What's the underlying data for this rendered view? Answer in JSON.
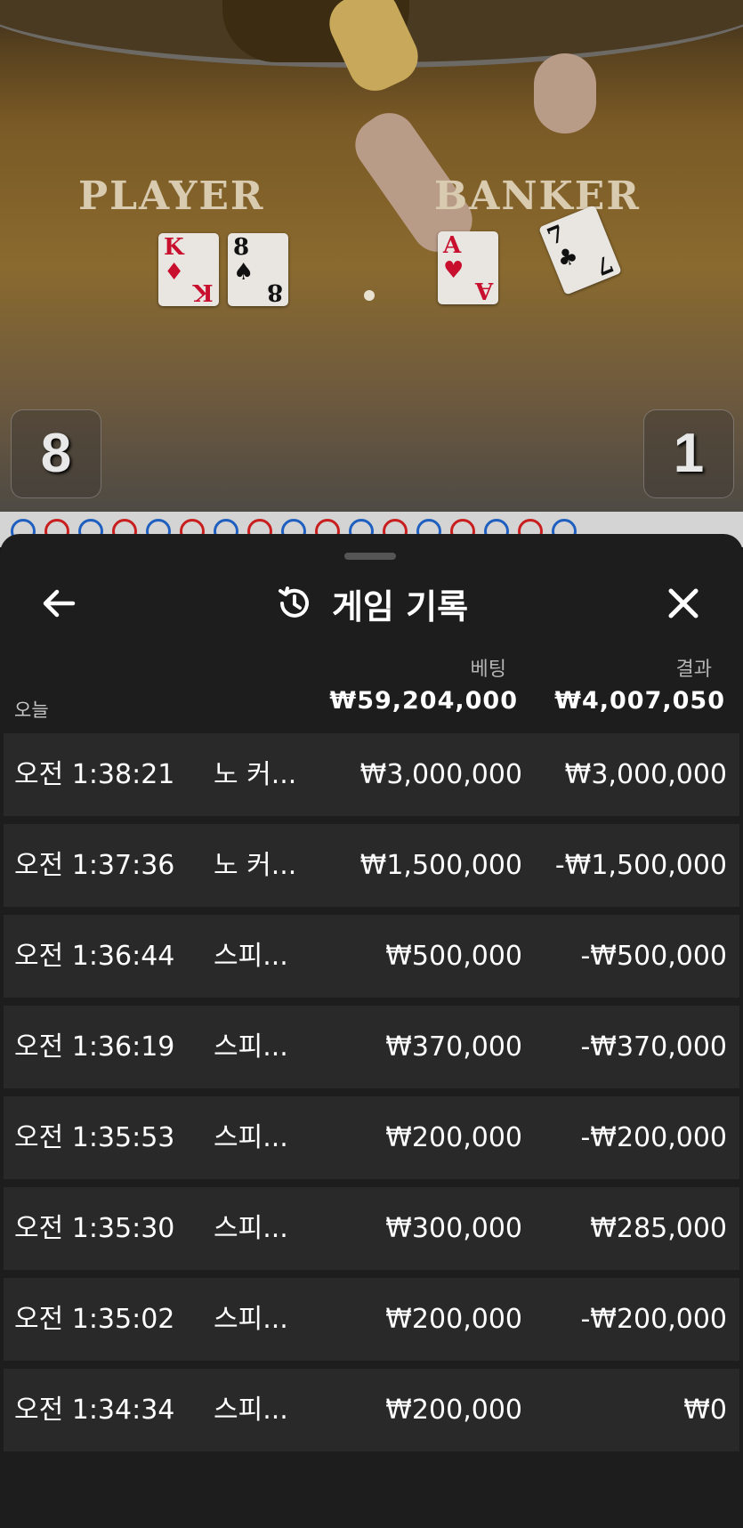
{
  "video": {
    "player_label": "PLAYER",
    "banker_label": "BANKER",
    "player_score": "8",
    "banker_score": "1",
    "player_cards": [
      {
        "rank": "K",
        "suit": "♦",
        "color": "red"
      },
      {
        "rank": "8",
        "suit": "♠",
        "color": "black"
      }
    ],
    "banker_cards": [
      {
        "rank": "A",
        "suit": "♥",
        "color": "red"
      },
      {
        "rank": "7",
        "suit": "♣",
        "color": "black"
      }
    ]
  },
  "road": [
    "p",
    "b",
    "p",
    "b",
    "p",
    "b",
    "p",
    "b",
    "p",
    "b",
    "p",
    "b",
    "p",
    "b",
    "p",
    "b",
    "p"
  ],
  "history": {
    "title": "게임 기록",
    "back_icon": "arrow-left-icon",
    "history_icon": "history-clock-icon",
    "close_icon": "close-x-icon",
    "bet_header": "베팅",
    "result_header": "결과",
    "today_label": "오늘",
    "total_bet": "₩59,204,000",
    "total_result": "₩4,007,050",
    "rows": [
      {
        "time": "오전 1:38:21",
        "game": "노 커...",
        "bet": "₩3,000,000",
        "result": "₩3,000,000"
      },
      {
        "time": "오전 1:37:36",
        "game": "노 커...",
        "bet": "₩1,500,000",
        "result": "-₩1,500,000"
      },
      {
        "time": "오전 1:36:44",
        "game": "스피...",
        "bet": "₩500,000",
        "result": "-₩500,000"
      },
      {
        "time": "오전 1:36:19",
        "game": "스피...",
        "bet": "₩370,000",
        "result": "-₩370,000"
      },
      {
        "time": "오전 1:35:53",
        "game": "스피...",
        "bet": "₩200,000",
        "result": "-₩200,000"
      },
      {
        "time": "오전 1:35:30",
        "game": "스피...",
        "bet": "₩300,000",
        "result": "₩285,000"
      },
      {
        "time": "오전 1:35:02",
        "game": "스피...",
        "bet": "₩200,000",
        "result": "-₩200,000"
      },
      {
        "time": "오전 1:34:34",
        "game": "스피...",
        "bet": "₩200,000",
        "result": "₩0"
      }
    ]
  }
}
